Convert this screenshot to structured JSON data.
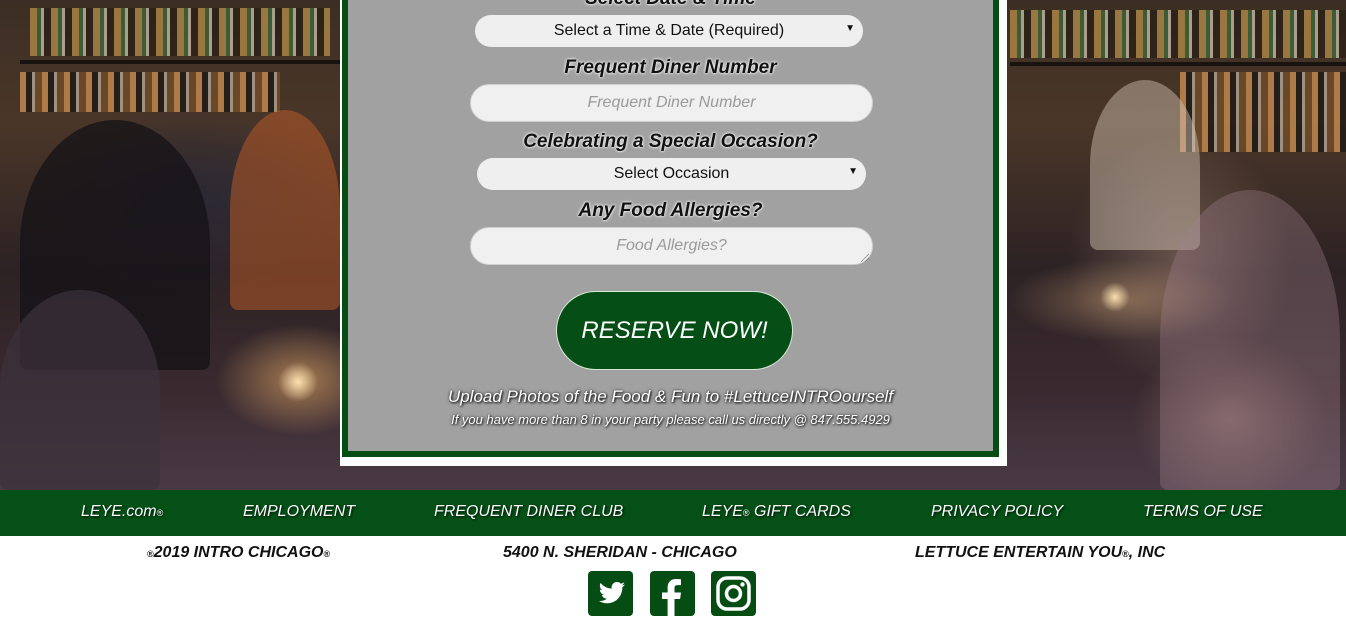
{
  "form": {
    "date_time_heading": "Select Date & Time",
    "date_time_select": "Select a Time & Date (Required)",
    "frequent_diner_heading": "Frequent Diner Number",
    "frequent_diner_placeholder": "Frequent Diner Number",
    "occasion_heading": "Celebrating a Special Occasion?",
    "occasion_select": "Select Occasion",
    "allergies_heading": "Any Food Allergies?",
    "allergies_placeholder": "Food Allergies?",
    "submit_label": "RESERVE NOW!",
    "upload_note": "Upload Photos of the Food & Fun to #LettuceINTROourself",
    "party_note": "If you have more than 8 in your party please call us directly @ 847.555.4929"
  },
  "nav": {
    "leye": "LEYE.com",
    "employment": "EMPLOYMENT",
    "frequent_diner_club": "FREQUENT DINER CLUB",
    "gift_cards_prefix": "LEYE",
    "gift_cards_suffix": " GIFT CARDS",
    "privacy": "PRIVACY POLICY",
    "terms": "TERMS OF USE",
    "registered_mark": "®"
  },
  "footer": {
    "copyright_year": "2019 INTRO CHICAGO",
    "address": "5400 N. SHERIDAN - CHICAGO",
    "company_prefix": "LETTUCE ENTERTAIN YOU",
    "company_suffix": ", INC",
    "registered_mark": "®"
  },
  "social": {
    "icons": [
      "twitter-icon",
      "facebook-icon",
      "instagram-icon"
    ],
    "color": "#064d14"
  },
  "colors": {
    "brand_green": "#045016",
    "panel_gray": "#8c8c8c"
  }
}
